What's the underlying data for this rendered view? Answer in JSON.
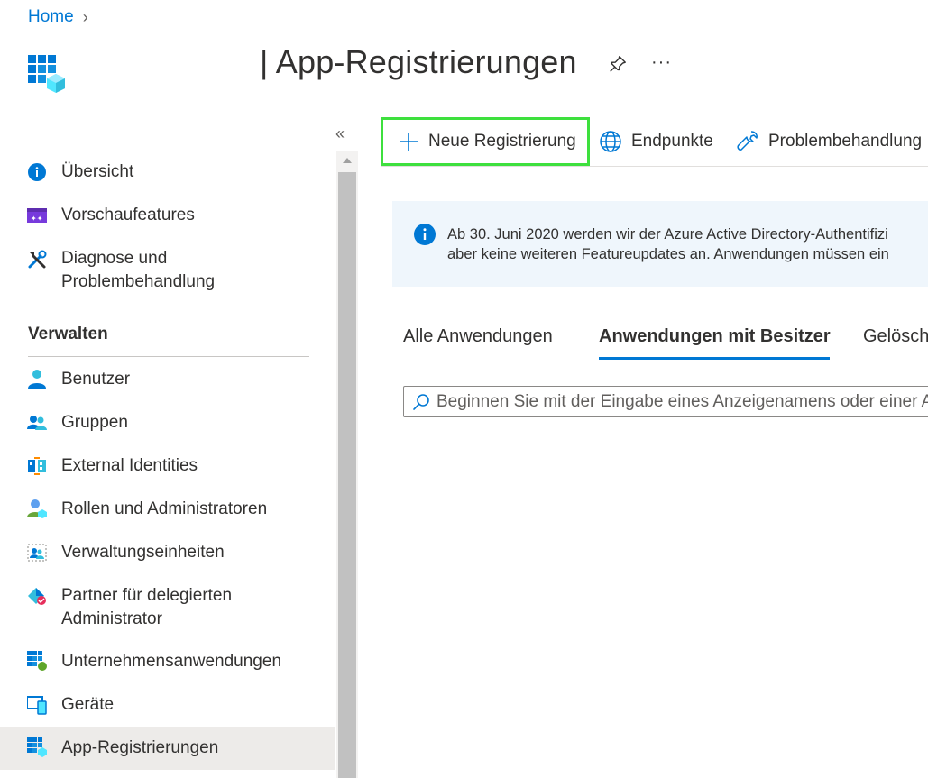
{
  "breadcrumb": {
    "home": "Home",
    "separator": "›"
  },
  "page": {
    "title": "| App-Registrierungen",
    "more": "···"
  },
  "sidebar": {
    "collapse": "«",
    "items_top": [
      {
        "label": "Übersicht",
        "icon": "info-icon"
      },
      {
        "label": "Vorschaufeatures",
        "icon": "preview-features-icon"
      },
      {
        "label_line1": "Diagnose und",
        "label_line2": "Problembehandlung",
        "icon": "tools-icon"
      }
    ],
    "section": "Verwalten",
    "items_manage": [
      {
        "label": "Benutzer",
        "icon": "user-icon"
      },
      {
        "label": "Gruppen",
        "icon": "groups-icon"
      },
      {
        "label": "External Identities",
        "icon": "external-identities-icon"
      },
      {
        "label": "Rollen und Administratoren",
        "icon": "roles-icon"
      },
      {
        "label": "Verwaltungseinheiten",
        "icon": "admin-units-icon"
      },
      {
        "label_line1": "Partner für delegierten",
        "label_line2": "Administrator",
        "icon": "partner-icon"
      },
      {
        "label": "Unternehmensanwendungen",
        "icon": "enterprise-apps-icon"
      },
      {
        "label": "Geräte",
        "icon": "devices-icon"
      },
      {
        "label": "App-Registrierungen",
        "icon": "app-registrations-icon",
        "selected": true
      }
    ]
  },
  "toolbar": {
    "new_registration": "Neue Registrierung",
    "endpoints": "Endpunkte",
    "troubleshooting": "Problembehandlung"
  },
  "banner": {
    "line1": "Ab 30. Juni 2020 werden wir der Azure Active Directory-Authentifizi",
    "line2": "aber keine weiteren Featureupdates an. Anwendungen müssen ein"
  },
  "tabs": {
    "all": "Alle Anwendungen",
    "owned": "Anwendungen mit Besitzer",
    "deleted": "Gelösch"
  },
  "search": {
    "placeholder": "Beginnen Sie mit der Eingabe eines Anzeigenamens oder einer A"
  },
  "colors": {
    "accent": "#0078d4",
    "highlight_box": "#3ee03e",
    "banner_bg": "#eff6fc",
    "selected_bg": "#edebe9"
  }
}
